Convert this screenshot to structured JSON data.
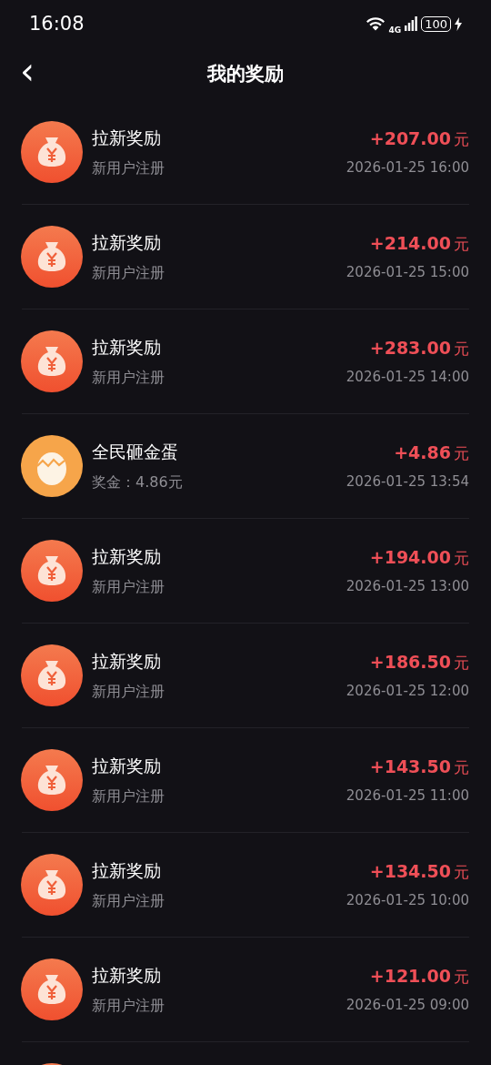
{
  "status_bar": {
    "time": "16:08",
    "network": "4G",
    "battery": "100"
  },
  "header": {
    "back": "‹",
    "title": "我的奖励"
  },
  "rewards": [
    {
      "kind": "money",
      "title": "拉新奖励",
      "subtitle": "新用户注册",
      "amount": "+207.00",
      "unit": "元",
      "time": "2026-01-25 16:00"
    },
    {
      "kind": "money",
      "title": "拉新奖励",
      "subtitle": "新用户注册",
      "amount": "+214.00",
      "unit": "元",
      "time": "2026-01-25 15:00"
    },
    {
      "kind": "money",
      "title": "拉新奖励",
      "subtitle": "新用户注册",
      "amount": "+283.00",
      "unit": "元",
      "time": "2026-01-25 14:00"
    },
    {
      "kind": "egg",
      "title": "全民砸金蛋",
      "subtitle": "奖金：4.86元",
      "amount": "+4.86",
      "unit": "元",
      "time": "2026-01-25 13:54"
    },
    {
      "kind": "money",
      "title": "拉新奖励",
      "subtitle": "新用户注册",
      "amount": "+194.00",
      "unit": "元",
      "time": "2026-01-25 13:00"
    },
    {
      "kind": "money",
      "title": "拉新奖励",
      "subtitle": "新用户注册",
      "amount": "+186.50",
      "unit": "元",
      "time": "2026-01-25 12:00"
    },
    {
      "kind": "money",
      "title": "拉新奖励",
      "subtitle": "新用户注册",
      "amount": "+143.50",
      "unit": "元",
      "time": "2026-01-25 11:00"
    },
    {
      "kind": "money",
      "title": "拉新奖励",
      "subtitle": "新用户注册",
      "amount": "+134.50",
      "unit": "元",
      "time": "2026-01-25 10:00"
    },
    {
      "kind": "money",
      "title": "拉新奖励",
      "subtitle": "新用户注册",
      "amount": "+121.00",
      "unit": "元",
      "time": "2026-01-25 09:00"
    },
    {
      "kind": "money"
    }
  ]
}
